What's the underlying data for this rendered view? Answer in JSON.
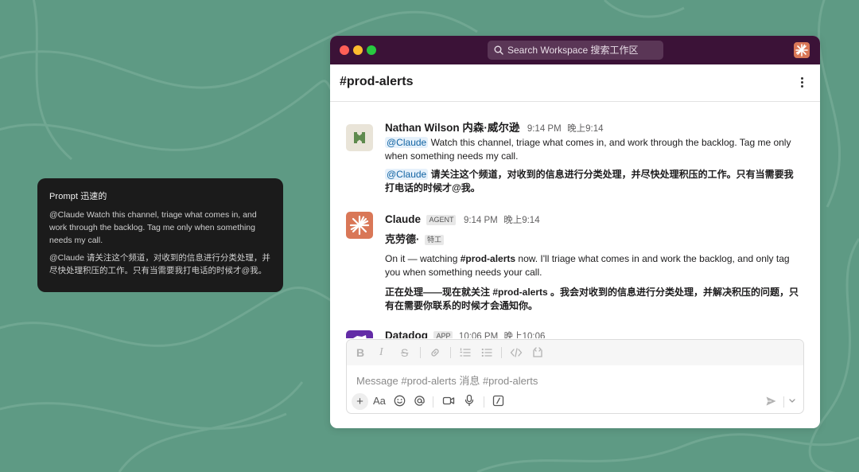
{
  "prompt": {
    "title": "Prompt 迅速的",
    "text_en": "@Claude Watch this channel, triage what comes in, and work through the backlog. Tag me only when something needs my call.",
    "text_cn": "@Claude 请关注这个频道，对收到的信息进行分类处理，并尽快处理积压的工作。只有当需要我打电话的时候才@我。"
  },
  "window": {
    "search_placeholder": "Search Workspace 搜索工作区",
    "channel_name": "#prod-alerts"
  },
  "messages": [
    {
      "author": "Nathan Wilson 内森·威尔逊",
      "time": "9:14 PM",
      "time_cn": "晚上9:14",
      "mention": "@Claude",
      "text_en": "Watch this channel, triage what comes in, and work through the backlog. Tag me only when something needs my call.",
      "mention_cn": "@Claude",
      "text_cn": "请关注这个频道，对收到的信息进行分类处理，并尽快处理积压的工作。只有当需要我打电话的时候才@我。"
    },
    {
      "author": "Claude",
      "tag": "AGENT",
      "time": "9:14 PM",
      "time_cn": "晚上9:14",
      "name_cn": "克劳德·",
      "tag_cn": "特工",
      "text_en_1": "On it — watching ",
      "text_en_bold": "#prod-alerts",
      "text_en_2": " now. I'll triage what comes in and work the backlog, and only tag you when something needs your call.",
      "text_cn_1": "正在处理——现在就关注 ",
      "text_cn_bold": "#prod-alerts",
      "text_cn_2": " 。我会对收到的信息进行分类处理，并解决积压的问题，只有在需要你联系的时候才会通知你。"
    },
    {
      "author": "Datadog",
      "tag": "APP",
      "time": "10:06 PM",
      "time_cn": "晚上10:06"
    }
  ],
  "composer": {
    "placeholder": "Message #prod-alerts 消息 #prod-alerts",
    "format_bold": "B",
    "format_italic": "I",
    "format_strike": "S",
    "text_tool": "Aa"
  },
  "colors": {
    "background": "#5e9a84",
    "titlebar": "#3b1237",
    "claude": "#d97757",
    "mention_bg": "#e6f1fb",
    "mention_text": "#1264a3"
  }
}
